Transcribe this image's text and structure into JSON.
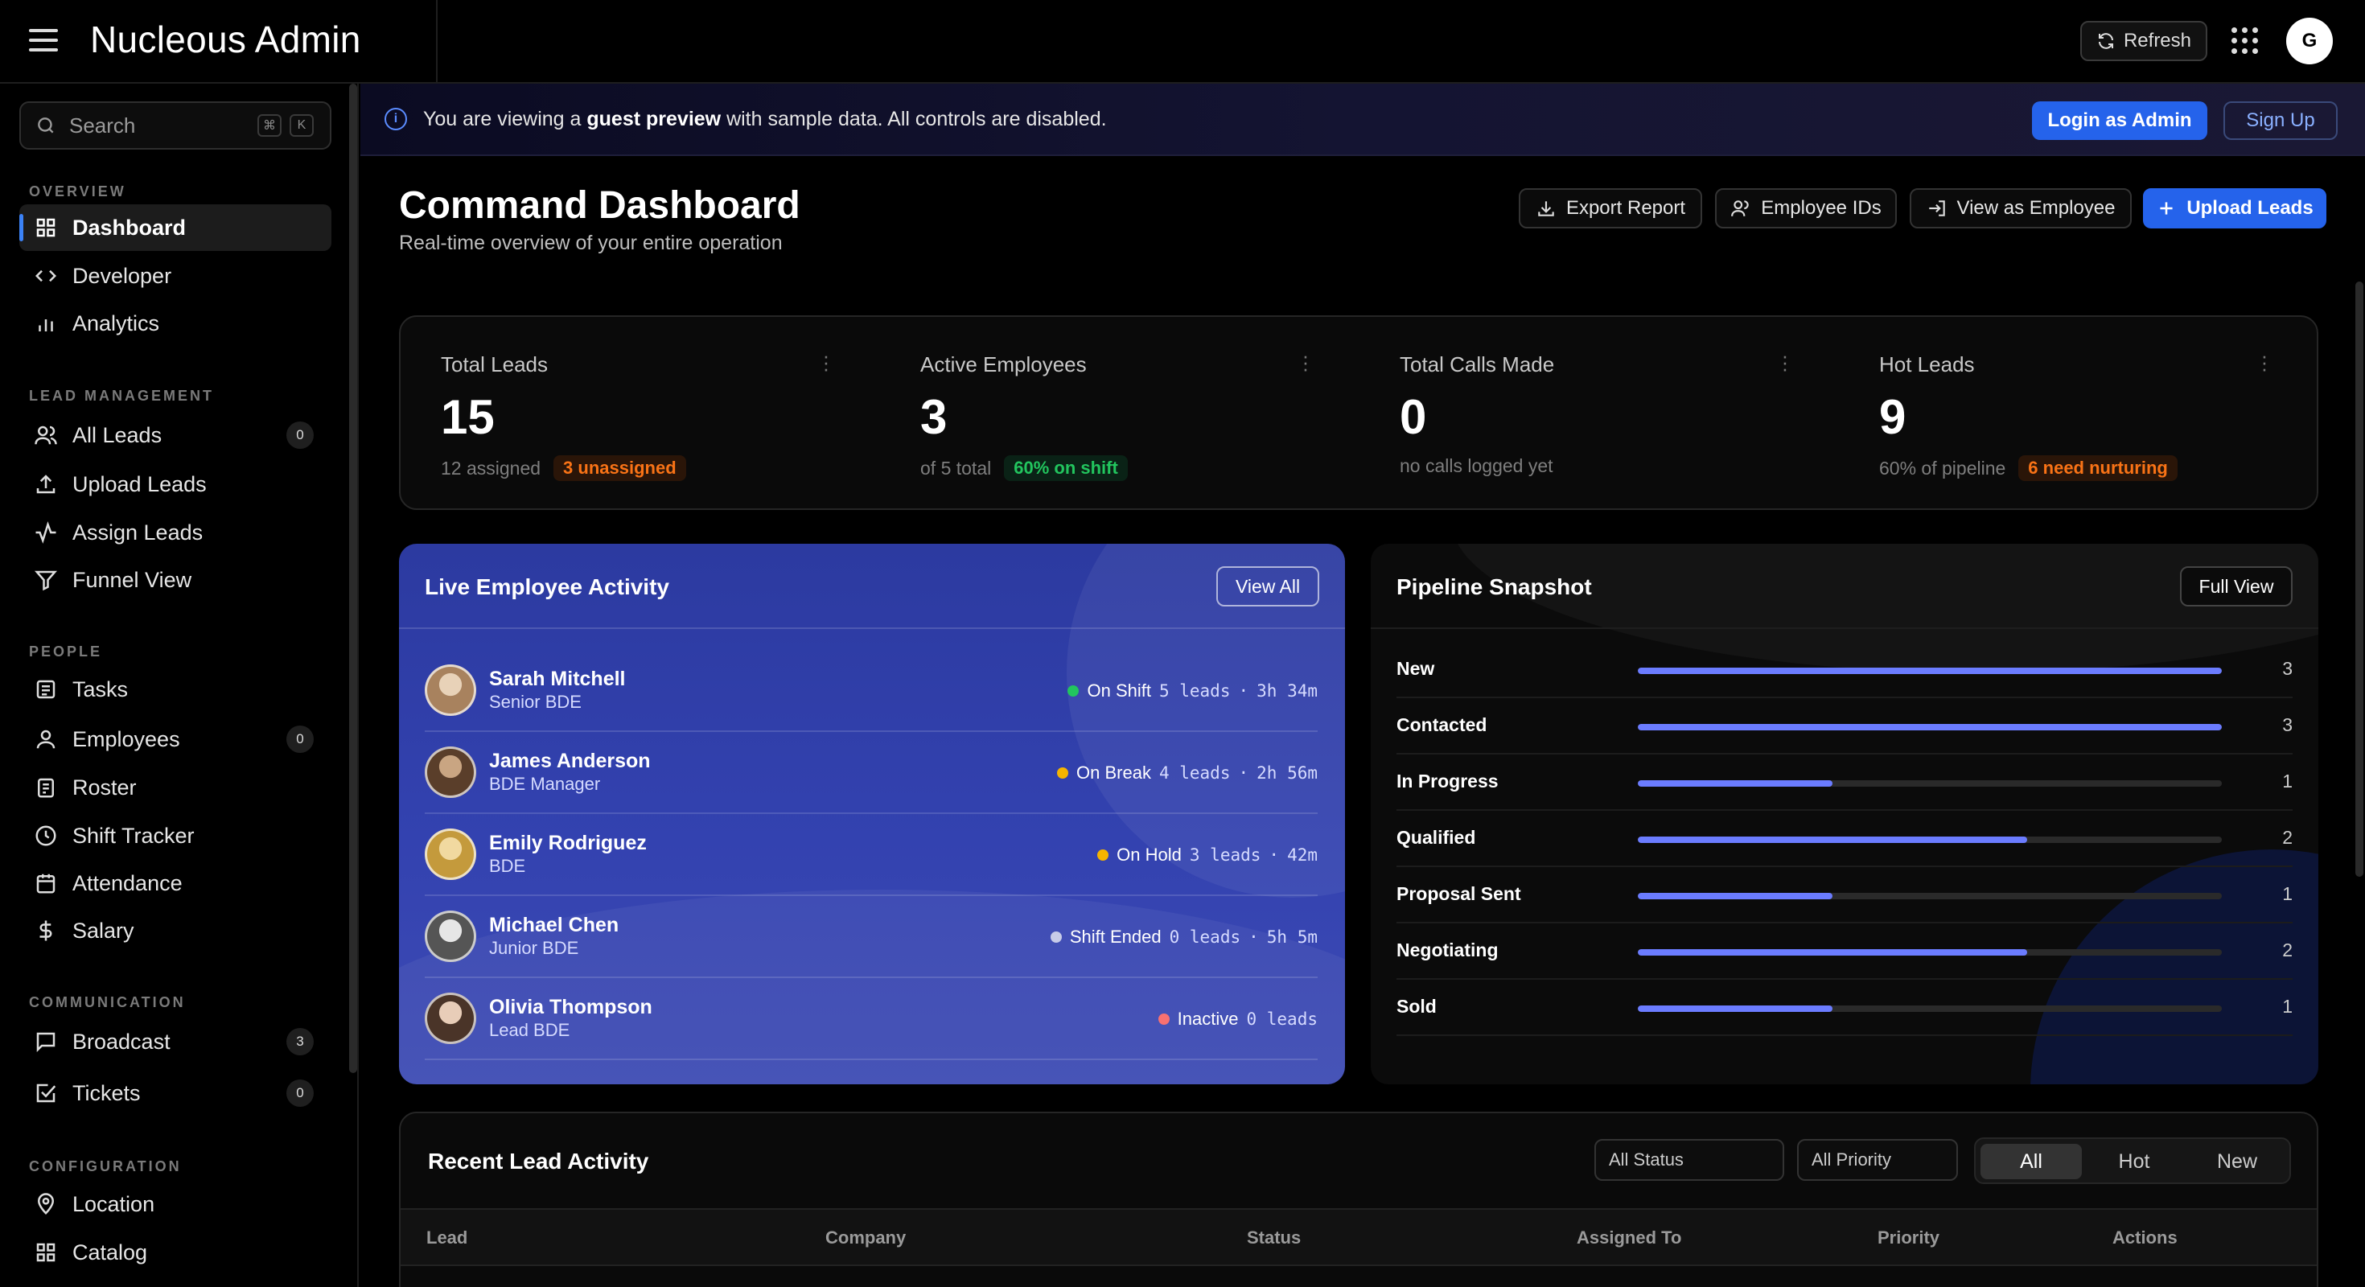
{
  "app": {
    "title": "Nucleous Admin",
    "refresh_label": "Refresh",
    "avatar_initial": "G"
  },
  "sidebar": {
    "search_placeholder": "Search",
    "search_kbd": [
      "⌘",
      "K"
    ],
    "sections": {
      "overview": "OVERVIEW",
      "lead_management": "LEAD MANAGEMENT",
      "people": "PEOPLE",
      "communication": "COMMUNICATION",
      "configuration": "CONFIGURATION"
    },
    "items": {
      "dashboard": "Dashboard",
      "developer": "Developer",
      "analytics": "Analytics",
      "all_leads": "All Leads",
      "all_leads_badge": "0",
      "upload_leads": "Upload Leads",
      "assign_leads": "Assign Leads",
      "funnel_view": "Funnel View",
      "tasks": "Tasks",
      "employees": "Employees",
      "employees_badge": "0",
      "roster": "Roster",
      "shift_tracker": "Shift Tracker",
      "attendance": "Attendance",
      "salary": "Salary",
      "broadcast": "Broadcast",
      "broadcast_badge": "3",
      "tickets": "Tickets",
      "tickets_badge": "0",
      "location": "Location",
      "catalog": "Catalog"
    }
  },
  "banner": {
    "prefix": "You are viewing a ",
    "bold": "guest preview",
    "suffix": " with sample data. All controls are disabled.",
    "login_label": "Login as Admin",
    "signup_label": "Sign Up"
  },
  "header": {
    "title": "Command Dashboard",
    "subtitle": "Real-time overview of your entire operation",
    "export_label": "Export Report",
    "employee_ids_label": "Employee IDs",
    "view_as_label": "View as Employee",
    "upload_label": "Upload Leads"
  },
  "stats": [
    {
      "label": "Total Leads",
      "value": "15",
      "sub": "12 assigned",
      "pill": "3 unassigned"
    },
    {
      "label": "Active Employees",
      "value": "3",
      "sub": "of 5 total",
      "pill": "60% on shift"
    },
    {
      "label": "Total Calls Made",
      "value": "0",
      "sub": "no calls logged yet",
      "pill": ""
    },
    {
      "label": "Hot Leads",
      "value": "9",
      "sub": "60% of pipeline",
      "pill": "6 need nurturing"
    }
  ],
  "live": {
    "title": "Live Employee Activity",
    "view_all": "View All",
    "employees": [
      {
        "name": "Sarah Mitchell",
        "role": "Senior BDE",
        "status": "On Shift",
        "status_color": "#22c55e",
        "leads": "5 leads",
        "time": "3h 34m"
      },
      {
        "name": "James Anderson",
        "role": "BDE Manager",
        "status": "On Break",
        "status_color": "#f5b400",
        "leads": "4 leads",
        "time": "2h 56m"
      },
      {
        "name": "Emily Rodriguez",
        "role": "BDE",
        "status": "On Hold",
        "status_color": "#f5b400",
        "leads": "3 leads",
        "time": "42m"
      },
      {
        "name": "Michael Chen",
        "role": "Junior BDE",
        "status": "Shift Ended",
        "status_color": "#c7cbe8",
        "leads": "0 leads",
        "time": "5h 5m"
      },
      {
        "name": "Olivia Thompson",
        "role": "Lead BDE",
        "status": "Inactive",
        "status_color": "#f87171",
        "leads": "0 leads",
        "time": ""
      }
    ]
  },
  "pipeline": {
    "title": "Pipeline Snapshot",
    "full_view": "Full View",
    "max": 3,
    "stages": [
      {
        "label": "New",
        "value": 3
      },
      {
        "label": "Contacted",
        "value": 3
      },
      {
        "label": "In Progress",
        "value": 1
      },
      {
        "label": "Qualified",
        "value": 2
      },
      {
        "label": "Proposal Sent",
        "value": 1
      },
      {
        "label": "Negotiating",
        "value": 2
      },
      {
        "label": "Sold",
        "value": 1
      }
    ]
  },
  "recent": {
    "title": "Recent Lead Activity",
    "status_filter": "All Status",
    "priority_filter": "All Priority",
    "segments": [
      "All",
      "Hot",
      "New"
    ],
    "columns": [
      "Lead",
      "Company",
      "Status",
      "Assigned To",
      "Priority",
      "Actions"
    ]
  },
  "colors": {
    "accent": "#2563eb",
    "bar": "#6b7cff",
    "orange": "#f97316",
    "green": "#22c55e"
  }
}
